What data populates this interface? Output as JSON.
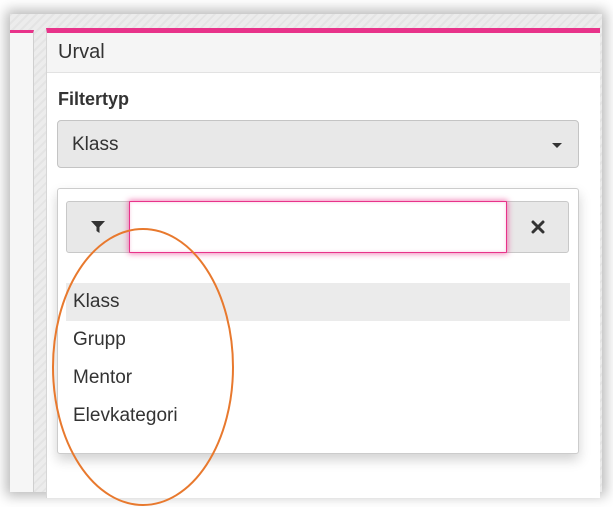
{
  "panel": {
    "title": "Urval",
    "filter_label": "Filtertyp",
    "selected_value": "Klass"
  },
  "dropdown": {
    "search_value": "",
    "filter_icon": "filter-icon",
    "clear_icon": "close-icon",
    "options": [
      {
        "label": "Klass",
        "highlighted": true
      },
      {
        "label": "Grupp",
        "highlighted": false
      },
      {
        "label": "Mentor",
        "highlighted": false
      },
      {
        "label": "Elevkategori",
        "highlighted": false
      }
    ]
  },
  "colors": {
    "accent": "#e8338a",
    "annotation": "#e8792e",
    "select_bg": "#e8e8e8"
  }
}
